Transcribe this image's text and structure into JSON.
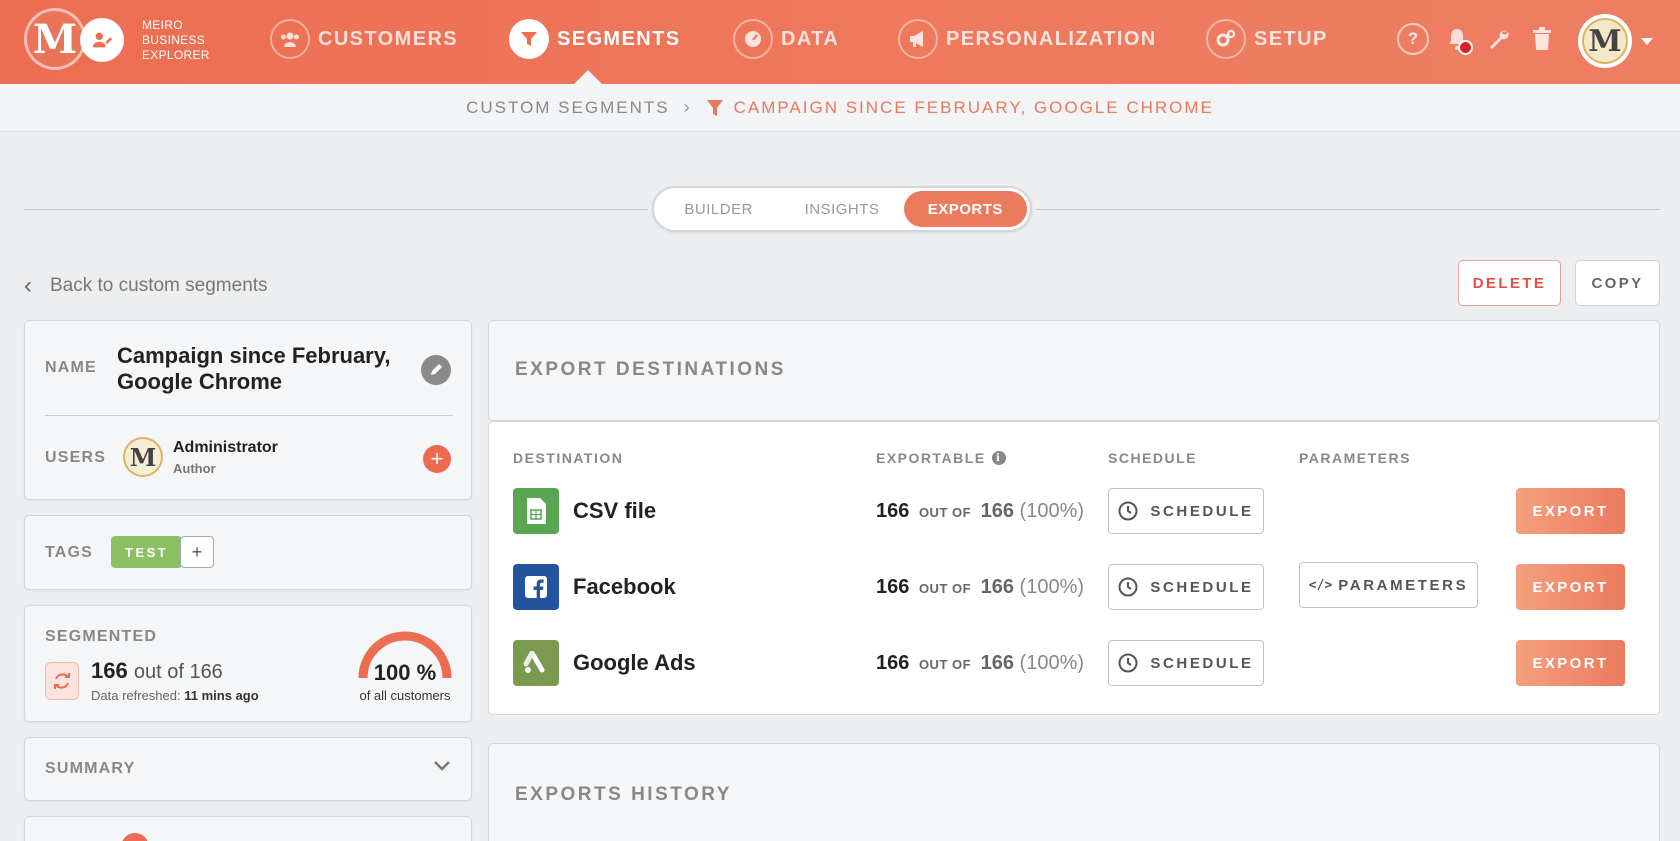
{
  "colors": {
    "accent": "#ec6d52",
    "export_button": "#ec7a5f",
    "tag_green": "#8cc063",
    "delete_red": "#e14f44"
  },
  "brand": {
    "line1": "MEIRO",
    "line2": "BUSINESS",
    "line3": "EXPLORER",
    "logo_letter": "M"
  },
  "nav": {
    "customers": "CUSTOMERS",
    "segments": "SEGMENTS",
    "data": "DATA",
    "personalization": "PERSONALIZATION",
    "setup": "SETUP",
    "help": "?",
    "avatar_letter": "M"
  },
  "breadcrumb": {
    "parent": "CUSTOM SEGMENTS",
    "current": "CAMPAIGN SINCE FEBRUARY, GOOGLE CHROME"
  },
  "tabs": {
    "builder": "BUILDER",
    "insights": "INSIGHTS",
    "exports": "EXPORTS"
  },
  "back_link": "Back to custom segments",
  "actions": {
    "delete": "DELETE",
    "copy": "COPY"
  },
  "segment": {
    "name_label": "NAME",
    "name_line1": "Campaign since February,",
    "name_line2": "Google Chrome",
    "users_label": "USERS",
    "user_name": "Administrator",
    "user_role": "Author",
    "user_avatar_letter": "M",
    "tags_label": "TAGS",
    "tag": "TEST",
    "tag_add": "+",
    "segmented_label": "SEGMENTED",
    "count": "166",
    "count_of": "out of 166",
    "refreshed_prefix": "Data refreshed:",
    "refreshed_value": "11 mins ago",
    "percent": "100 %",
    "percent_value": 100,
    "percent_sub": "of all customers",
    "summary_label": "SUMMARY"
  },
  "exports": {
    "title": "EXPORT DESTINATIONS",
    "headers": {
      "destination": "DESTINATION",
      "exportable": "EXPORTABLE",
      "schedule": "SCHEDULE",
      "parameters": "PARAMETERS"
    },
    "rows": [
      {
        "name": "CSV file",
        "icon": "csv-file-icon",
        "icon_color": "#5aa552",
        "count": "166",
        "of": "OUT OF",
        "total": "166",
        "percent": "(100%)",
        "schedule": "SCHEDULE",
        "export": "EXPORT"
      },
      {
        "name": "Facebook",
        "icon": "facebook-icon",
        "icon_color": "#23539d",
        "count": "166",
        "of": "OUT OF",
        "total": "166",
        "percent": "(100%)",
        "schedule": "SCHEDULE",
        "parameters": "PARAMETERS",
        "export": "EXPORT"
      },
      {
        "name": "Google Ads",
        "icon": "google-ads-icon",
        "icon_color": "#7a9a4f",
        "count": "166",
        "of": "OUT OF",
        "total": "166",
        "percent": "(100%)",
        "schedule": "SCHEDULE",
        "export": "EXPORT"
      }
    ],
    "history_title": "EXPORTS HISTORY"
  }
}
